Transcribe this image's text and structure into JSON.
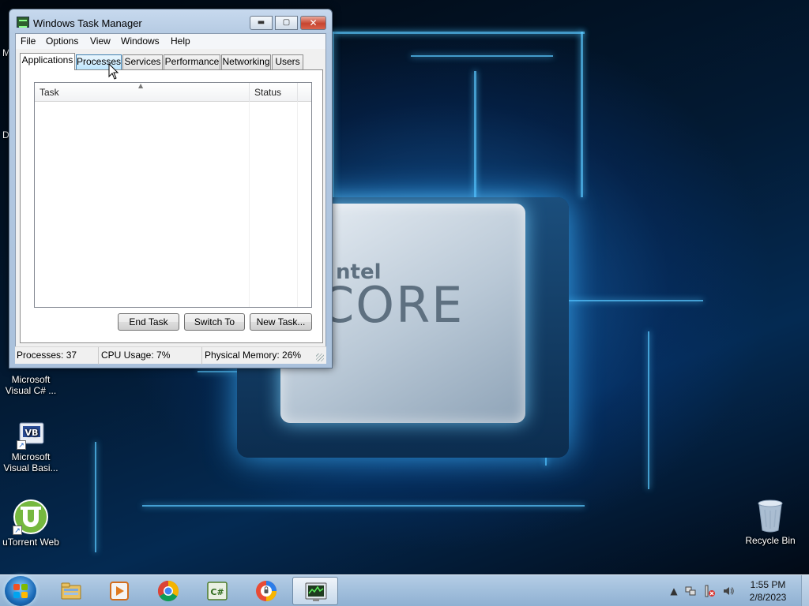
{
  "window": {
    "title": "Windows Task Manager",
    "min_glyph": "▬",
    "max_glyph": "▢",
    "close_glyph": "✕"
  },
  "menu": [
    "File",
    "Options",
    "View",
    "Windows",
    "Help"
  ],
  "tabs": [
    "Applications",
    "Processes",
    "Services",
    "Performance",
    "Networking",
    "Users"
  ],
  "active_tab": "Applications",
  "hovered_tab": "Processes",
  "listview": {
    "columns": [
      "Task",
      "Status"
    ],
    "rows": []
  },
  "buttons": {
    "end_task": "End Task",
    "switch_to": "Switch To",
    "new_task": "New Task..."
  },
  "status": {
    "processes": "Processes: 37",
    "cpu": "CPU Usage: 7%",
    "memory": "Physical Memory: 26%"
  },
  "desktop": {
    "edge_fragments": [
      "M",
      "D"
    ],
    "icons": [
      {
        "label_line1": "Microsoft",
        "label_line2": "Visual C# ...",
        "icon": "visual-csharp-icon"
      },
      {
        "label_line1": "Microsoft",
        "label_line2": "Visual Basi...",
        "icon": "visual-basic-icon",
        "badge": "VB"
      },
      {
        "label_line1": "uTorrent Web",
        "label_line2": "",
        "icon": "utorrent-icon"
      },
      {
        "label_line1": "Recycle Bin",
        "label_line2": "",
        "icon": "recycle-bin-icon"
      }
    ],
    "wallpaper_text": {
      "brand": "ntel",
      "product": "CORE"
    }
  },
  "taskbar": {
    "apps": [
      "file-explorer-icon",
      "media-player-icon",
      "chrome-icon",
      "csharp-studio-icon",
      "vpn-shield-icon",
      "task-manager-icon"
    ],
    "csharp_label": "C#",
    "clock_time": "1:55 PM",
    "clock_date": "2/8/2023"
  },
  "colors": {
    "accent": "#1b6bb8",
    "close_red": "#c7452f",
    "utorrent_green": "#76b83f"
  }
}
